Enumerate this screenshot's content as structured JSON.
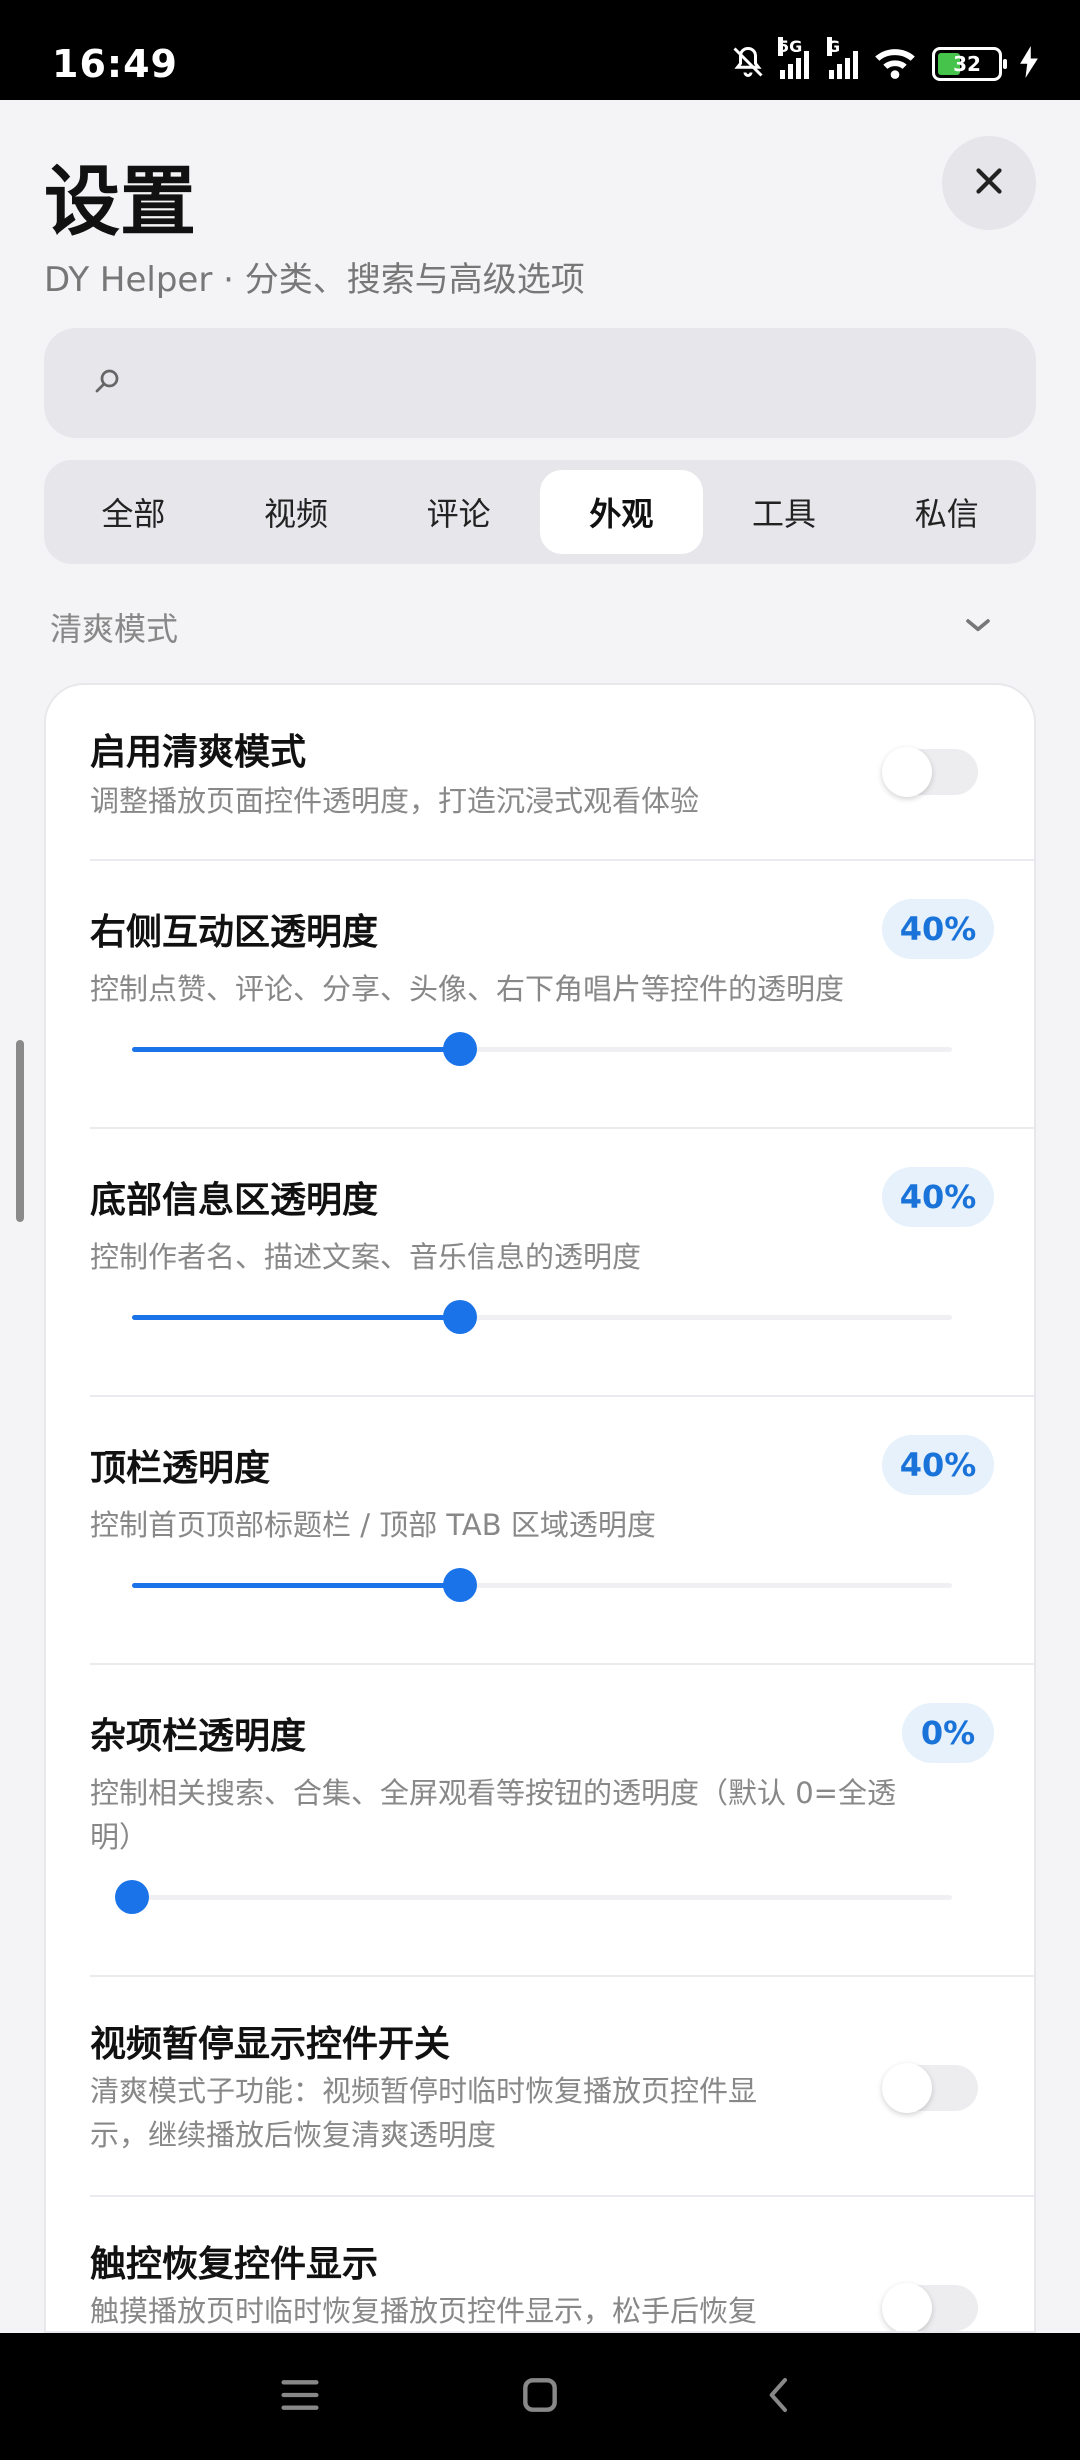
{
  "status_bar": {
    "time": "16:49",
    "network_1": "5G",
    "network_2": "G",
    "battery": "32",
    "icons": [
      "mute-bell-icon",
      "signal-icon",
      "signal-icon",
      "wifi-icon",
      "battery-icon",
      "charging-icon"
    ]
  },
  "header": {
    "title": "设置",
    "subtitle": "DY Helper · 分类、搜索与高级选项"
  },
  "search": {
    "placeholder": "",
    "value": ""
  },
  "tabs": [
    {
      "label": "全部",
      "active": false
    },
    {
      "label": "视频",
      "active": false
    },
    {
      "label": "评论",
      "active": false
    },
    {
      "label": "外观",
      "active": true
    },
    {
      "label": "工具",
      "active": false
    },
    {
      "label": "私信",
      "active": false
    }
  ],
  "section": {
    "title": "清爽模式"
  },
  "settings": [
    {
      "title": "启用清爽模式",
      "desc": "调整播放页面控件透明度，打造沉浸式观看体验",
      "type": "toggle",
      "on": false
    },
    {
      "title": "右侧互动区透明度",
      "desc": "控制点赞、评论、分享、头像、右下角唱片等控件的透明度",
      "type": "slider",
      "value_label": "40%",
      "value": 40
    },
    {
      "title": "底部信息区透明度",
      "desc": "控制作者名、描述文案、音乐信息的透明度",
      "type": "slider",
      "value_label": "40%",
      "value": 40
    },
    {
      "title": "顶栏透明度",
      "desc": "控制首页顶部标题栏 / 顶部 TAB 区域透明度",
      "type": "slider",
      "value_label": "40%",
      "value": 40
    },
    {
      "title": "杂项栏透明度",
      "desc_line1": "控制相关搜索、合集、全屏观看等按钮的透明度（默认 0=全透",
      "desc_line2": "明）",
      "type": "slider",
      "value_label": "0%",
      "value": 0
    },
    {
      "title": "视频暂停显示控件开关",
      "desc_line1": "清爽模式子功能：视频暂停时临时恢复播放页控件显",
      "desc_line2": "示，继续播放后恢复清爽透明度",
      "type": "toggle",
      "on": false
    },
    {
      "title": "触控恢复控件显示",
      "desc": "触摸播放页时临时恢复播放页控件显示，松手后恢复",
      "type": "toggle",
      "on": false
    }
  ],
  "colors": {
    "accent": "#1a73e8",
    "badge_bg": "#e6f1fc",
    "badge_text": "#1a73d9",
    "page_bg": "#f4f4f6"
  },
  "navbar": {
    "icons": [
      "menu-icon",
      "home-icon",
      "back-icon"
    ]
  }
}
